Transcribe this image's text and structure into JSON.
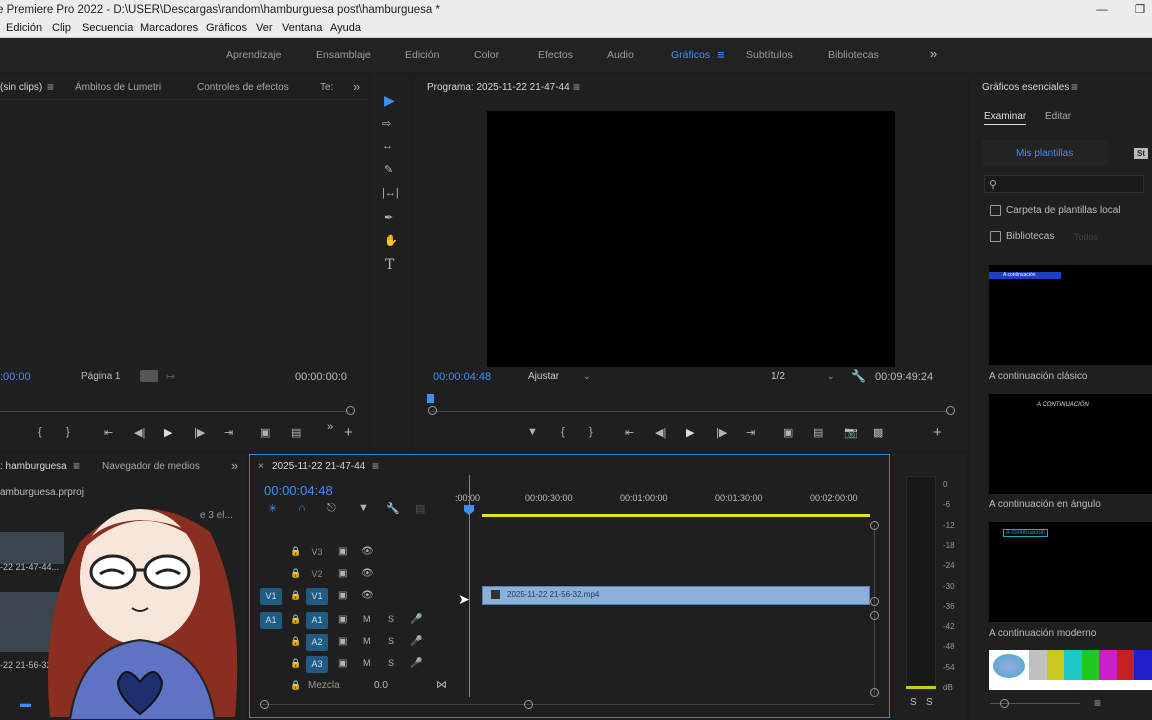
{
  "titlebar": {
    "title": "e Premiere Pro 2022 - D:\\USER\\Descargas\\random\\hamburguesa post\\hamburguesa *"
  },
  "menu": [
    "Edición",
    "Clip",
    "Secuencia",
    "Marcadores",
    "Gráficos",
    "Ver",
    "Ventana",
    "Ayuda"
  ],
  "workspaces": [
    "Aprendizaje",
    "Ensamblaje",
    "Edición",
    "Color",
    "Efectos",
    "Audio",
    "Gráficos",
    "Subtítulos",
    "Bibliotecas"
  ],
  "workspace_active": "Gráficos",
  "source_panel": {
    "tabs": [
      "(sin clips)",
      "Ámbitos de Lumetri",
      "Controles de efectos",
      "Te:"
    ],
    "timecode_left": ":00:00",
    "page": "Página 1",
    "timecode_right": "00:00:00:0"
  },
  "program_panel": {
    "title": "Programa: 2025-11-22 21-47-44",
    "timecode": "00:00:04:48",
    "fit": "Ajustar",
    "resolution": "1/2",
    "duration": "00:09:49:24"
  },
  "project_panel": {
    "tabs": [
      ": hamburguesa",
      "Navegador de medios"
    ],
    "file": "amburguesa.prproj",
    "count": "e 3 el...",
    "items": [
      "-22 21-47-44...",
      "-22 21-56-32..."
    ]
  },
  "timeline": {
    "sequence": "2025-11-22 21-47-44",
    "timecode": "00:00:04:48",
    "ruler": [
      ":00:00",
      "00:00:30:00",
      "00:01:00:00",
      "00:01:30:00",
      "00:02:00:00"
    ],
    "video_tracks": [
      {
        "name": "V3",
        "src": ""
      },
      {
        "name": "V2",
        "src": ""
      },
      {
        "name": "V1",
        "src": "V1"
      }
    ],
    "audio_tracks": [
      {
        "name": "A1",
        "src": "A1",
        "m": "M",
        "s": "S"
      },
      {
        "name": "A2",
        "src": "",
        "m": "M",
        "s": "S"
      },
      {
        "name": "A3",
        "src": "",
        "m": "M",
        "s": "S"
      }
    ],
    "mix_label": "Mezcla",
    "mix_value": "0.0",
    "clip_name": "2025-11-22 21-56-32.mp4"
  },
  "audio_meter": {
    "scale": [
      "0",
      "-6",
      "-12",
      "-18",
      "-24",
      "-30",
      "-36",
      "-42",
      "-48",
      "-54",
      "dB"
    ],
    "solo": [
      "S",
      "S"
    ]
  },
  "essential_graphics": {
    "title": "Gráficos esenciales",
    "tabs": [
      "Examinar",
      "Editar"
    ],
    "my_templates": "Mis plantillas",
    "stock_badge": "St",
    "search_placeholder": "",
    "local_templates": "Carpeta de plantillas local",
    "libraries": "Bibliotecas",
    "libraries_select": "Todos",
    "templates": [
      {
        "name": "A continuación clásico",
        "preview_text": "A continuación"
      },
      {
        "name": "A continuación en ángulo",
        "preview_text": "A CONTINUACIÓN"
      },
      {
        "name": "A continuación moderno",
        "preview_text": "A continuación"
      }
    ],
    "bar_colors": [
      "#c0c0c0",
      "#c8c820",
      "#20c8c8",
      "#20c820",
      "#c820c8",
      "#c82020",
      "#2020c8"
    ]
  },
  "colors": {
    "accent": "#3d8ef5",
    "clip": "#8ab0dc",
    "track_highlight": "#1f5b82",
    "yellow": "#e8e020"
  }
}
